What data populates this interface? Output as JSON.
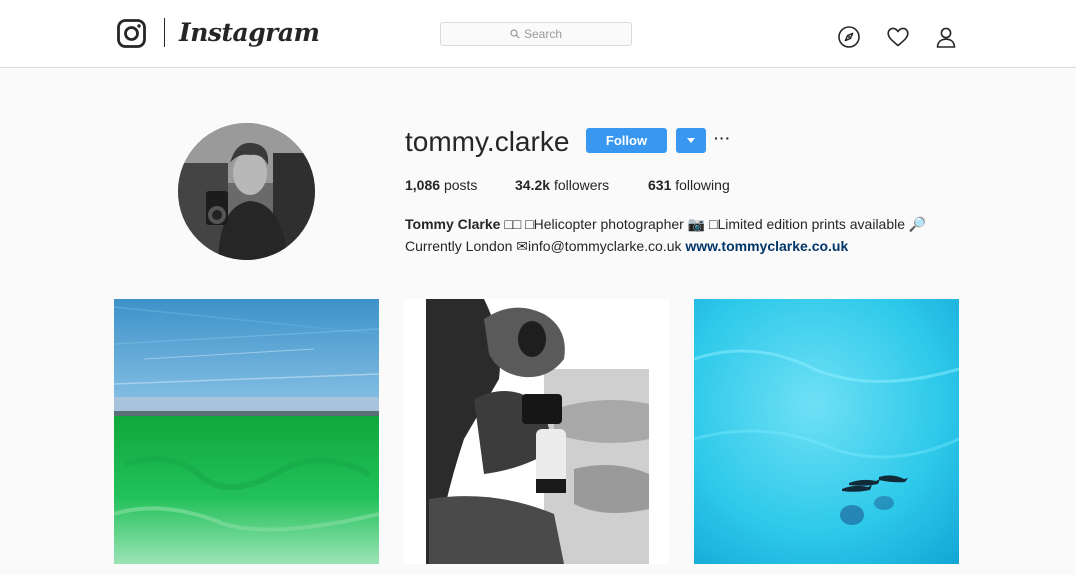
{
  "header": {
    "brand": "Instagram",
    "search_placeholder": "Search",
    "nav_icons": [
      "compass-icon",
      "heart-icon",
      "person-icon"
    ]
  },
  "profile": {
    "username": "tommy.clarke",
    "follow_label": "Follow",
    "options_label": "···",
    "stats": {
      "posts_count": "1,086",
      "posts_label": "posts",
      "followers_count": "34.2k",
      "followers_label": "followers",
      "following_count": "631",
      "following_label": "following"
    },
    "bio": {
      "name": "Tommy Clarke",
      "line1_text": " □□ □Helicopter photographer 📷 □Limited edition prints available 🔎",
      "line2_text": "Currently London ✉info@tommyclarke.co.uk ",
      "website": "www.tommyclarke.co.uk"
    }
  },
  "posts": [
    {
      "subject": "aerial-coast-photo"
    },
    {
      "subject": "photographer-portrait-photo"
    },
    {
      "subject": "aerial-dolphins-photo"
    }
  ],
  "colors": {
    "accent": "#3897f0",
    "link": "#003569",
    "background": "#fafafa",
    "text": "#262626"
  }
}
